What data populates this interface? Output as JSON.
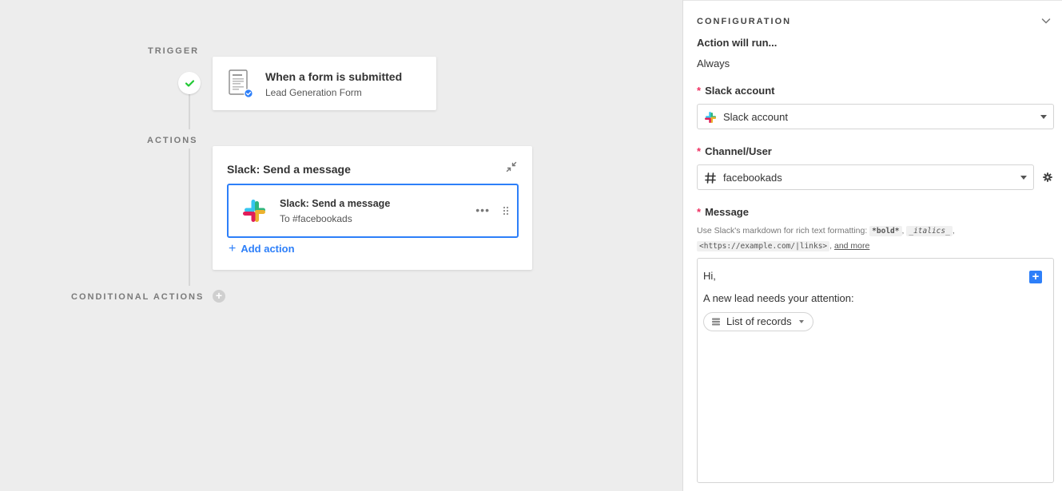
{
  "canvas": {
    "sections": {
      "trigger": "TRIGGER",
      "actions": "ACTIONS",
      "conditional": "CONDITIONAL ACTIONS"
    },
    "trigger_card": {
      "title": "When a form is submitted",
      "subtitle": "Lead Generation Form",
      "icon": "form-document-icon",
      "status_icon": "check-icon"
    },
    "actions_card": {
      "title": "Slack: Send a message",
      "items": [
        {
          "title": "Slack: Send a message",
          "subtitle": "To #facebookads",
          "icon": "slack-icon"
        }
      ],
      "more_glyph": "•••",
      "add_action_label": "Add action"
    },
    "add_conditional_glyph": "+"
  },
  "panel": {
    "header": "CONFIGURATION",
    "run_label": "Action will run...",
    "run_value": "Always",
    "slack_account": {
      "required_mark": "*",
      "label": "Slack account",
      "value": "Slack account"
    },
    "channel": {
      "required_mark": "*",
      "label": "Channel/User",
      "value": "facebookads"
    },
    "message": {
      "required_mark": "*",
      "label": "Message",
      "help_prefix": "Use Slack's markdown for rich text formatting:",
      "help_bold": "*bold*",
      "help_sep1": ",",
      "help_italics": "_italics_",
      "help_sep2": ",",
      "help_link": "<https://example.com/|links>",
      "help_sep3": ",",
      "help_more": "and more",
      "body_line1": "Hi,",
      "body_line2": "A new lead needs your attention:",
      "token_label": "List of records",
      "insert_glyph": "+"
    }
  },
  "colors": {
    "accent": "#2d7ff9",
    "required": "#ef3061",
    "success": "#20c933",
    "canvas_bg": "#ededed"
  }
}
